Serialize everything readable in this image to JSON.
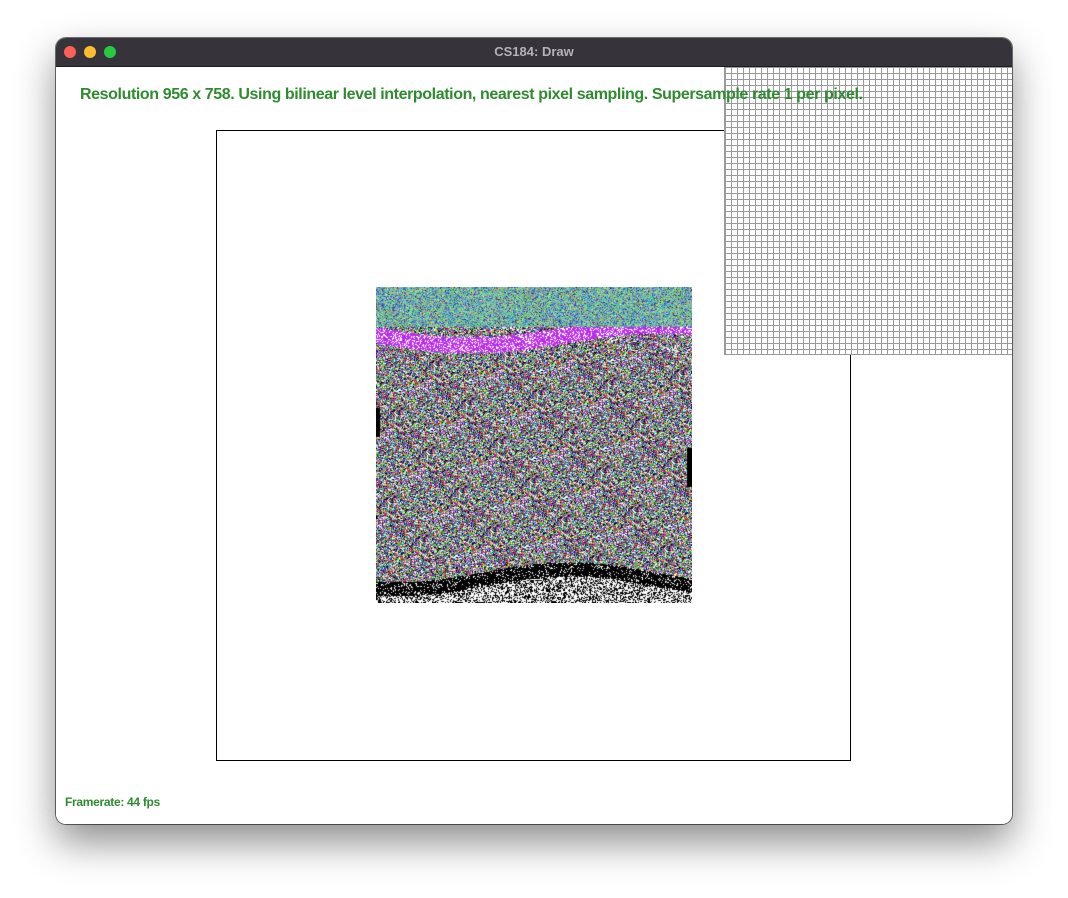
{
  "window": {
    "title": "CS184: Draw"
  },
  "status": {
    "text": "Resolution 956 x 758. Using bilinear level interpolation, nearest pixel sampling. Supersample rate 1 per pixel."
  },
  "footer": {
    "framerate": "Framerate: 44 fps"
  },
  "colors": {
    "status_text": "#2e8b2e",
    "titlebar": "#36343a",
    "close": "#fe5f57",
    "minimize": "#febc2e",
    "maximize": "#28c840"
  },
  "icons": [
    "close-icon",
    "minimize-icon",
    "maximize-icon"
  ]
}
